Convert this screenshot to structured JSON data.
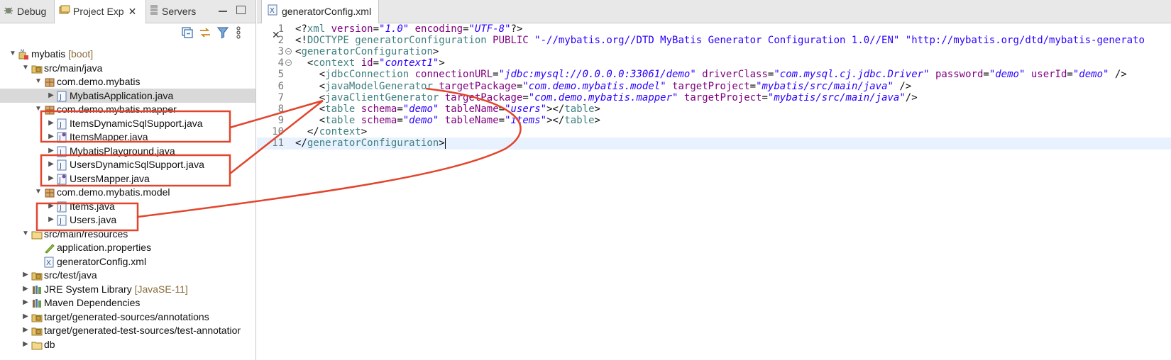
{
  "left_panel": {
    "tabs": [
      {
        "label": "Debug"
      },
      {
        "label": "Project Exp"
      },
      {
        "label": "Servers"
      }
    ],
    "tree": [
      {
        "label": "mybatis",
        "suffix": "[boot]",
        "icon": "maven-project-icon",
        "depth": 0,
        "expanded": true
      },
      {
        "label": "src/main/java",
        "icon": "source-folder-icon",
        "depth": 1,
        "expanded": true
      },
      {
        "label": "com.demo.mybatis",
        "icon": "package-icon",
        "depth": 2,
        "expanded": true
      },
      {
        "label": "MybatisApplication.java",
        "icon": "java-file-icon",
        "depth": 3,
        "expanded": false,
        "selected": true
      },
      {
        "label": "com.demo.mybatis.mapper",
        "icon": "package-icon",
        "depth": 2,
        "expanded": true
      },
      {
        "label": "ItemsDynamicSqlSupport.java",
        "icon": "java-file-icon",
        "depth": 3,
        "expanded": false
      },
      {
        "label": "ItemsMapper.java",
        "icon": "java-interface-icon",
        "depth": 3,
        "expanded": false
      },
      {
        "label": "MybatisPlayground.java",
        "icon": "java-file-icon",
        "depth": 3,
        "expanded": false
      },
      {
        "label": "UsersDynamicSqlSupport.java",
        "icon": "java-file-icon",
        "depth": 3,
        "expanded": false
      },
      {
        "label": "UsersMapper.java",
        "icon": "java-interface-icon",
        "depth": 3,
        "expanded": false
      },
      {
        "label": "com.demo.mybatis.model",
        "icon": "package-icon",
        "depth": 2,
        "expanded": true
      },
      {
        "label": "Items.java",
        "icon": "java-file-icon",
        "depth": 3,
        "expanded": false
      },
      {
        "label": "Users.java",
        "icon": "java-file-icon",
        "depth": 3,
        "expanded": false
      },
      {
        "label": "src/main/resources",
        "icon": "folder-icon",
        "depth": 1,
        "expanded": true
      },
      {
        "label": "application.properties",
        "icon": "properties-icon",
        "depth": 2,
        "leaf": true
      },
      {
        "label": "generatorConfig.xml",
        "icon": "xml-file-icon",
        "depth": 2,
        "leaf": true
      },
      {
        "label": "src/test/java",
        "icon": "source-folder-icon",
        "depth": 1,
        "expanded": false
      },
      {
        "label": "JRE System Library",
        "suffix": "[JavaSE-11]",
        "icon": "library-icon",
        "depth": 1,
        "expanded": false
      },
      {
        "label": "Maven Dependencies",
        "icon": "library-icon",
        "depth": 1,
        "expanded": false
      },
      {
        "label": "target/generated-sources/annotations",
        "icon": "source-folder-icon",
        "depth": 1,
        "expanded": false
      },
      {
        "label": "target/generated-test-sources/test-annotatior",
        "icon": "source-folder-icon",
        "depth": 1,
        "expanded": false
      },
      {
        "label": "db",
        "icon": "folder-icon",
        "depth": 1,
        "expanded": false
      }
    ]
  },
  "editor": {
    "tab_label": "generatorConfig.xml",
    "lines": [
      {
        "n": "1",
        "parts": [
          [
            "pun",
            "<?"
          ],
          [
            "tag",
            "xml "
          ],
          [
            "att",
            "version"
          ],
          [
            "pun",
            "="
          ],
          [
            "val",
            "\"1.0\""
          ],
          [
            "pun",
            " "
          ],
          [
            "att",
            "encoding"
          ],
          [
            "pun",
            "="
          ],
          [
            "val",
            "\"UTF-8\""
          ],
          [
            "pun",
            "?>"
          ]
        ]
      },
      {
        "n": "2",
        "parts": [
          [
            "pun",
            "<!"
          ],
          [
            "doc",
            "DOCTYPE generatorConfiguration "
          ],
          [
            "att",
            "PUBLIC "
          ],
          [
            "str",
            "\"-//mybatis.org//DTD MyBatis Generator Configuration 1.0//EN\""
          ],
          [
            "pun",
            " "
          ],
          [
            "str",
            "\"http://mybatis.org/dtd/mybatis-generato"
          ]
        ]
      },
      {
        "n": "3",
        "fold": true,
        "parts": [
          [
            "pun",
            "<"
          ],
          [
            "tag",
            "generatorConfiguration"
          ],
          [
            "pun",
            ">"
          ]
        ]
      },
      {
        "n": "4",
        "fold": true,
        "parts": [
          [
            "pun",
            "  <"
          ],
          [
            "tag",
            "context "
          ],
          [
            "att",
            "id"
          ],
          [
            "pun",
            "="
          ],
          [
            "val",
            "\"context1\""
          ],
          [
            "pun",
            ">"
          ]
        ]
      },
      {
        "n": "5",
        "parts": [
          [
            "pun",
            "    <"
          ],
          [
            "tag",
            "jdbcConnection "
          ],
          [
            "att",
            "connectionURL"
          ],
          [
            "pun",
            "="
          ],
          [
            "val",
            "\"jdbc:mysql://0.0.0.0:33061/demo\""
          ],
          [
            "pun",
            " "
          ],
          [
            "att",
            "driverClass"
          ],
          [
            "pun",
            "="
          ],
          [
            "val",
            "\"com.mysql.cj.jdbc.Driver\""
          ],
          [
            "pun",
            " "
          ],
          [
            "att",
            "password"
          ],
          [
            "pun",
            "="
          ],
          [
            "val",
            "\"demo\""
          ],
          [
            "pun",
            " "
          ],
          [
            "att",
            "userId"
          ],
          [
            "pun",
            "="
          ],
          [
            "val",
            "\"demo\""
          ],
          [
            "pun",
            " />"
          ]
        ]
      },
      {
        "n": "6",
        "parts": [
          [
            "pun",
            "    <"
          ],
          [
            "tag",
            "javaModelGenerator "
          ],
          [
            "att",
            "targetPackage"
          ],
          [
            "pun",
            "="
          ],
          [
            "val",
            "\"com.demo.mybatis.model\""
          ],
          [
            "pun",
            " "
          ],
          [
            "att",
            "targetProject"
          ],
          [
            "pun",
            "="
          ],
          [
            "val",
            "\"mybatis/src/main/java\""
          ],
          [
            "pun",
            " />"
          ]
        ]
      },
      {
        "n": "7",
        "parts": [
          [
            "pun",
            "    <"
          ],
          [
            "tag",
            "javaClientGenerator "
          ],
          [
            "att",
            "targetPackage"
          ],
          [
            "pun",
            "="
          ],
          [
            "val",
            "\"com.demo.mybatis.mapper\""
          ],
          [
            "pun",
            " "
          ],
          [
            "att",
            "targetProject"
          ],
          [
            "pun",
            "="
          ],
          [
            "val",
            "\"mybatis/src/main/java\""
          ],
          [
            "pun",
            "/>"
          ]
        ]
      },
      {
        "n": "8",
        "parts": [
          [
            "pun",
            "    <"
          ],
          [
            "tag",
            "table "
          ],
          [
            "att",
            "schema"
          ],
          [
            "pun",
            "="
          ],
          [
            "val",
            "\"demo\""
          ],
          [
            "pun",
            " "
          ],
          [
            "att",
            "tableName"
          ],
          [
            "pun",
            "="
          ],
          [
            "val",
            "\"users\""
          ],
          [
            "pun",
            "></"
          ],
          [
            "tag",
            "table"
          ],
          [
            "pun",
            ">"
          ]
        ]
      },
      {
        "n": "9",
        "parts": [
          [
            "pun",
            "    <"
          ],
          [
            "tag",
            "table "
          ],
          [
            "att",
            "schema"
          ],
          [
            "pun",
            "="
          ],
          [
            "val",
            "\"demo\""
          ],
          [
            "pun",
            " "
          ],
          [
            "att",
            "tableName"
          ],
          [
            "pun",
            "="
          ],
          [
            "val",
            "\"items\""
          ],
          [
            "pun",
            "></"
          ],
          [
            "tag",
            "table"
          ],
          [
            "pun",
            ">"
          ]
        ]
      },
      {
        "n": "10",
        "parts": [
          [
            "pun",
            "  </"
          ],
          [
            "tag",
            "context"
          ],
          [
            "pun",
            ">"
          ]
        ]
      },
      {
        "n": "11",
        "current": true,
        "parts": [
          [
            "pun",
            "</"
          ],
          [
            "tag",
            "generatorConfiguration"
          ],
          [
            "pun",
            ">"
          ]
        ]
      }
    ]
  },
  "colors": {
    "annotation": "#e2452c",
    "selection": "#d9d9d9",
    "current_line": "#e8f2fe"
  }
}
